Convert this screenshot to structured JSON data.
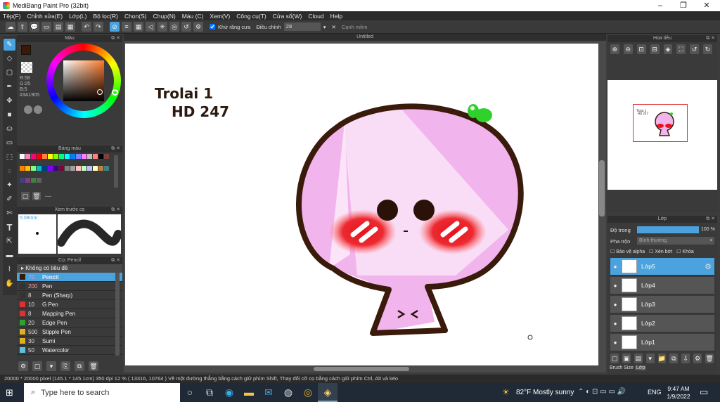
{
  "window": {
    "title": "MediBang Paint Pro (32bit)"
  },
  "menu": [
    "Tệp(F)",
    "Chỉnh sửa(E)",
    "Lớp(L)",
    "Bộ lọc(R)",
    "Chọn(S)",
    "Chụp(N)",
    "Màu (C)",
    "Xem(V)",
    "Công cụ(T)",
    "Cửa sổ(W)",
    "Cloud",
    "Help"
  ],
  "toolbar": {
    "antialias_label": "Khử răng cưa",
    "adjust_label": "Điều chỉnh",
    "adjust_value": "28",
    "softedge_label": "Cạnh mềm"
  },
  "color_panel": {
    "title": "Màu",
    "r": "R:58",
    "g": "G:25",
    "b": "B:5",
    "hex": "#3A1905",
    "current_color": "#3A1905",
    "bg_color": "#e03b1f"
  },
  "palette_panel": {
    "title": "Bảng màu",
    "footer": "---",
    "colors": [
      "#ffffff",
      "#ff80c0",
      "#ff0080",
      "#ff0000",
      "#ff8040",
      "#ffff00",
      "#80ff00",
      "#00ff80",
      "#00ffff",
      "#0080ff",
      "#8080ff",
      "#ff80ff",
      "#c0c0c0",
      "#ff8080",
      "#000000",
      "#804040",
      "#ff8000",
      "#ffc000",
      "#80ff80",
      "#00c0c0",
      "#004080",
      "#8000ff",
      "#400080",
      "#800040",
      "#808080",
      "#a0a0a0",
      "#ffc0c0",
      "#c0ffc0",
      "#c0c0ff",
      "#ffffc0",
      "#c08040",
      "#408080",
      "#404080",
      "#804080",
      "#408040",
      "#606060"
    ]
  },
  "preview_panel": {
    "title": "Xem trước cọ",
    "size": "5.08mm"
  },
  "brush_panel": {
    "title": "Cọ: Pencil",
    "group": "Không có tiêu đề",
    "items": [
      {
        "size": "70",
        "name": "Pencil",
        "color": "#3A1905"
      },
      {
        "size": "200",
        "name": "Pen",
        "color": "#333333"
      },
      {
        "size": "8",
        "name": "Pen (Sharp)",
        "color": "#333333"
      },
      {
        "size": "10",
        "name": "G Pen",
        "color": "#e03030"
      },
      {
        "size": "8",
        "name": "Mapping Pen",
        "color": "#e03030"
      },
      {
        "size": "20",
        "name": "Edge Pen",
        "color": "#30a030"
      },
      {
        "size": "500",
        "name": "Stipple Pen",
        "color": "#e0b020"
      },
      {
        "size": "30",
        "name": "Sumi",
        "color": "#e0b020"
      },
      {
        "size": "50",
        "name": "Watercolor",
        "color": "#60c0e0"
      }
    ]
  },
  "canvas": {
    "tab_title": "Untitled",
    "text_line1": "Trolai 1",
    "text_line2": "HD 247"
  },
  "nav_panel": {
    "title": "Hoa tiêu"
  },
  "layer_panel": {
    "title": "Lớp",
    "opacity_label": "Độ trong",
    "opacity_value": "100 %",
    "opacity": 100,
    "blend_label": "Pha trộn",
    "blend_value": "Bình thường",
    "protect_alpha": "Bảo vệ alpha",
    "clip": "Xén bớt",
    "lock": "Khóa",
    "layers": [
      "Lớp5",
      "Lớp4",
      "Lớp3",
      "Lớp2",
      "Lớp1"
    ],
    "tabs": [
      "Brush Size",
      "Lớp"
    ]
  },
  "status": {
    "text": "20000 * 20000 pixel   (145.1 * 145.1cm)   350 dpi   12 %   ( 13316, 10764 )   Vẽ một đường thẳng bằng cách giữ phím Shift, Thay đổi cỡ cọ bằng cách giữ phím Ctrl, Alt và kéo"
  },
  "taskbar": {
    "search_placeholder": "Type here to search",
    "weather": "82°F  Mostly sunny",
    "lang": "ENG",
    "time": "9:47 AM",
    "date": "1/9/2022"
  }
}
